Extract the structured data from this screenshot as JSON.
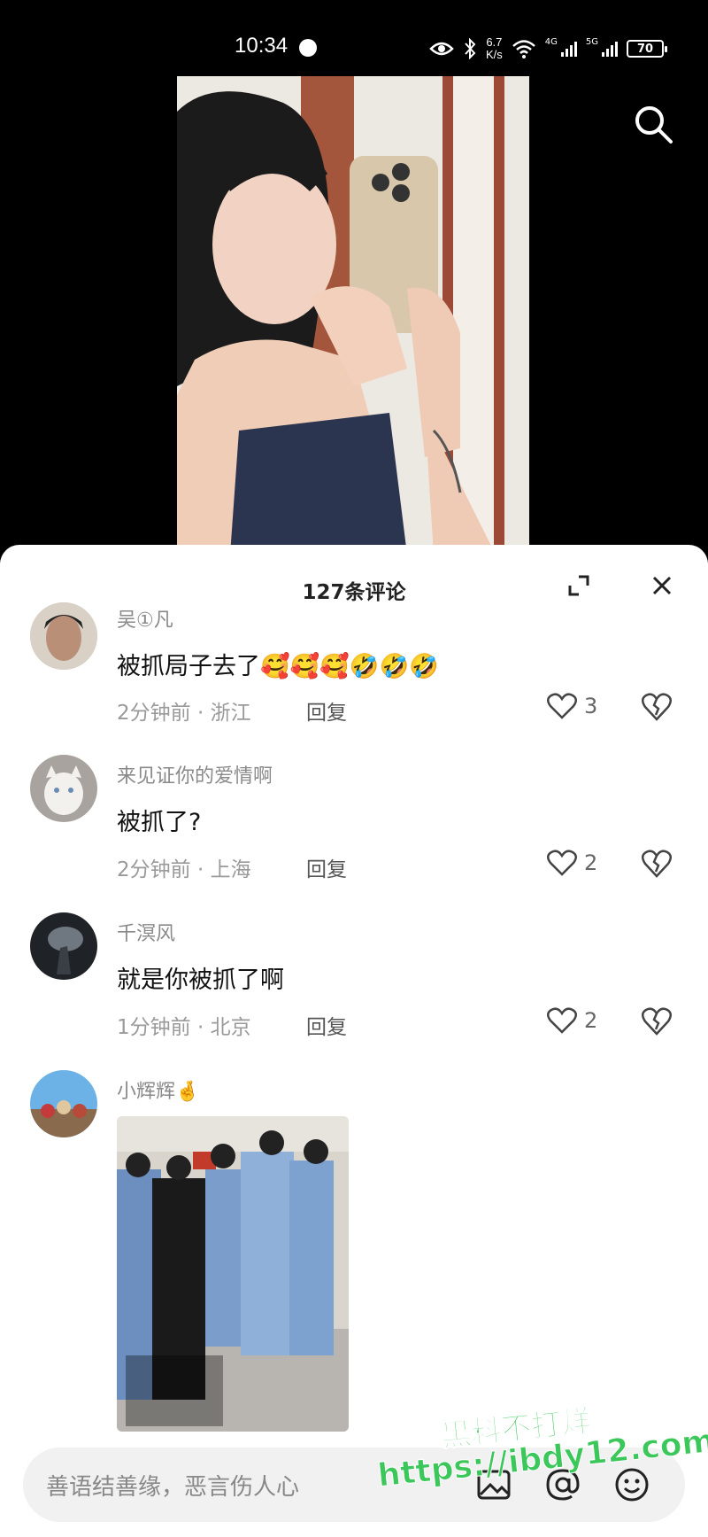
{
  "status_bar": {
    "time": "10:34",
    "speed_value": "6.7",
    "speed_unit": "K/s",
    "net1": "4G",
    "net2": "5G",
    "battery": "70"
  },
  "sheet": {
    "title": "127条评论"
  },
  "comments": [
    {
      "user": "吴①凡",
      "text": "被抓局子去了",
      "emoji": "🥰🥰🥰🤣🤣🤣",
      "time": "2分钟前",
      "location": "浙江",
      "reply": "回复",
      "likes": "3"
    },
    {
      "user": "来见证你的爱情啊",
      "text": "被抓了?",
      "time": "2分钟前",
      "location": "上海",
      "reply": "回复",
      "likes": "2"
    },
    {
      "user": "千溟风",
      "text": "就是你被抓了啊",
      "time": "1分钟前",
      "location": "北京",
      "reply": "回复",
      "likes": "2"
    },
    {
      "user": "小辉辉",
      "emoji": "🤞"
    }
  ],
  "input": {
    "placeholder": "善语结善缘，恶言伤人心"
  },
  "watermark": {
    "line1": "黑料不打烊",
    "line2": "https://ibdy12.com"
  },
  "colors": {
    "accent_text": "#111111",
    "meta_text": "#9a9a9a",
    "watermark": "#3cc75a"
  }
}
